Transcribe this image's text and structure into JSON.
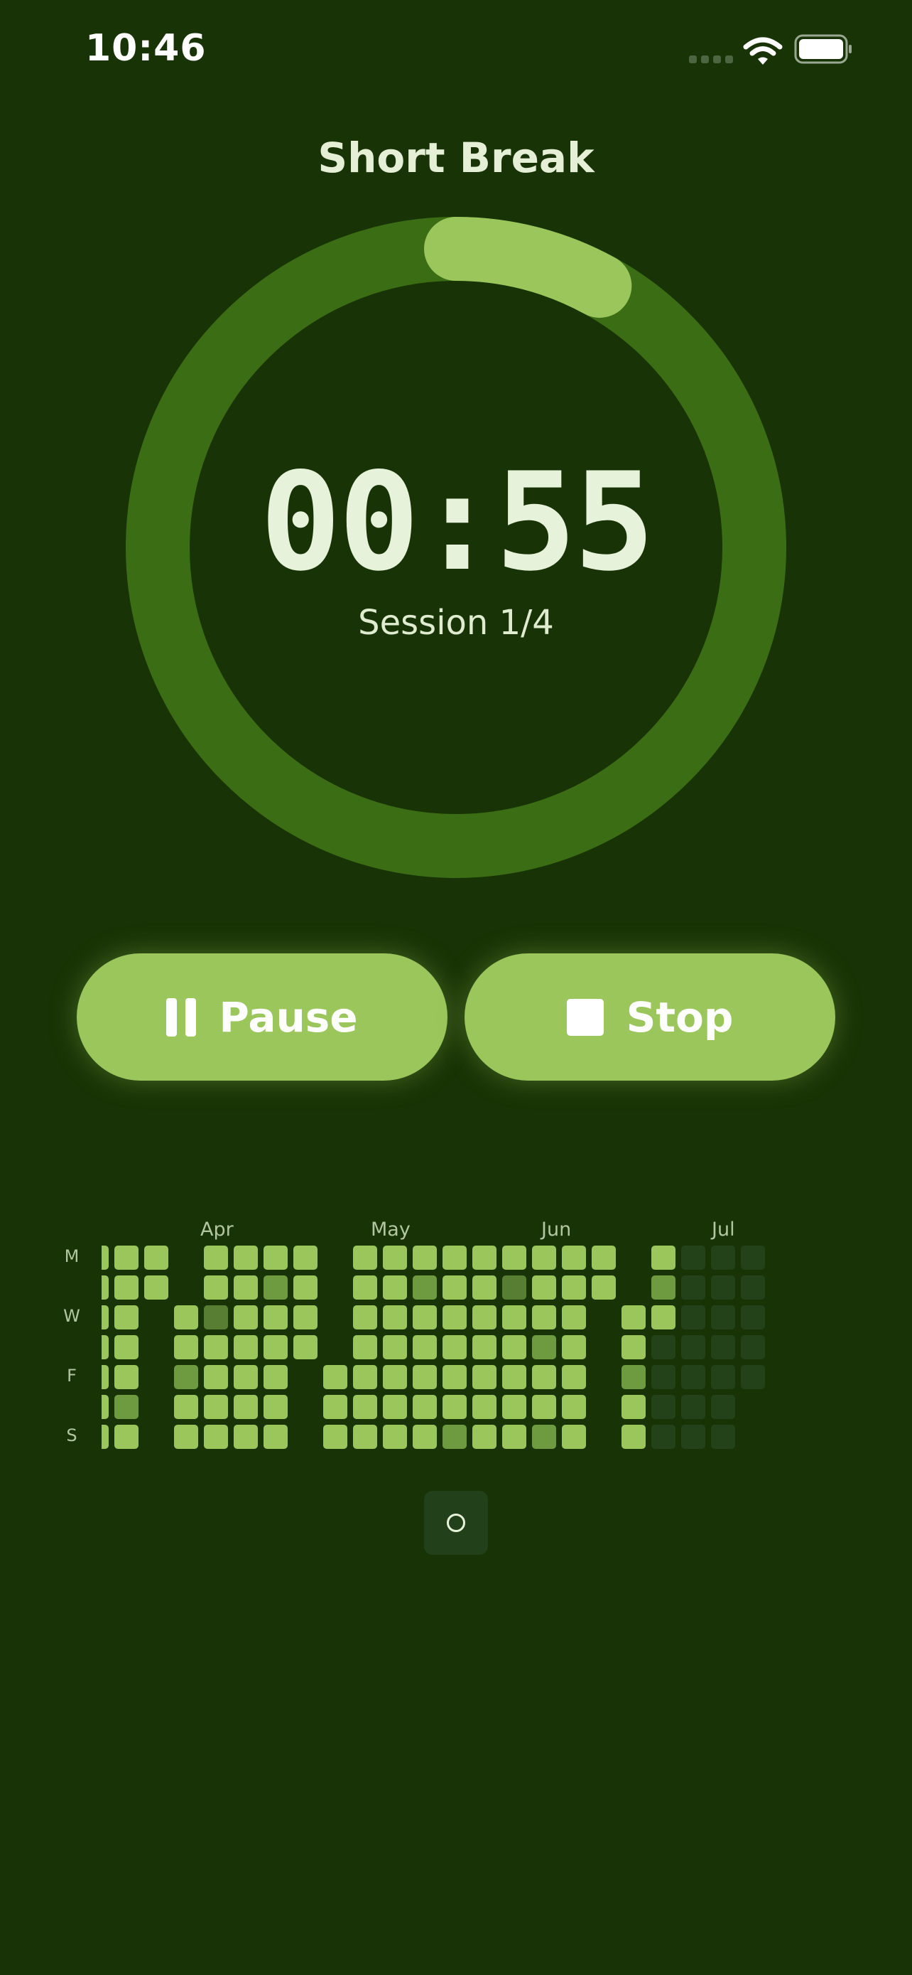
{
  "status_bar": {
    "time": "10:46"
  },
  "header": {
    "title": "Short Break"
  },
  "timer": {
    "display": "00:55",
    "session": "Session 1/4",
    "progress_fraction": 0.08
  },
  "controls": {
    "pause_label": "Pause",
    "stop_label": "Stop"
  },
  "heatmap": {
    "months": [
      "Apr",
      "May",
      "Jun",
      "Jul"
    ],
    "day_labels": [
      "M",
      "W",
      "F",
      "S"
    ],
    "weeks": [
      [
        3,
        3,
        3,
        3,
        3,
        3,
        3
      ],
      [
        3,
        3,
        3,
        3,
        3,
        2,
        3
      ],
      [
        3,
        3,
        -1,
        -1,
        -1,
        -1,
        -1
      ],
      [
        -1,
        -1,
        3,
        3,
        2,
        3,
        3
      ],
      [
        3,
        3,
        1,
        3,
        3,
        3,
        3
      ],
      [
        3,
        3,
        3,
        3,
        3,
        3,
        3
      ],
      [
        3,
        2,
        3,
        3,
        3,
        3,
        3
      ],
      [
        3,
        3,
        3,
        3,
        -1,
        -1,
        -1
      ],
      [
        -1,
        -1,
        -1,
        -1,
        3,
        3,
        3
      ],
      [
        3,
        3,
        3,
        3,
        3,
        3,
        3
      ],
      [
        3,
        3,
        3,
        3,
        3,
        3,
        3
      ],
      [
        3,
        2,
        3,
        3,
        3,
        3,
        3
      ],
      [
        3,
        3,
        3,
        3,
        3,
        3,
        2
      ],
      [
        3,
        3,
        3,
        3,
        3,
        3,
        3
      ],
      [
        3,
        1,
        3,
        3,
        3,
        3,
        3
      ],
      [
        3,
        3,
        3,
        2,
        3,
        3,
        2
      ],
      [
        3,
        3,
        3,
        3,
        3,
        3,
        3
      ],
      [
        3,
        3,
        -1,
        -1,
        -1,
        -1,
        -1
      ],
      [
        -1,
        -1,
        3,
        3,
        2,
        3,
        3
      ],
      [
        3,
        2,
        3,
        0,
        0,
        0,
        0
      ],
      [
        0,
        0,
        0,
        0,
        0,
        0,
        0
      ],
      [
        0,
        0,
        0,
        0,
        0,
        0,
        0
      ],
      [
        0,
        0,
        0,
        0,
        0,
        -1,
        -1
      ]
    ]
  }
}
